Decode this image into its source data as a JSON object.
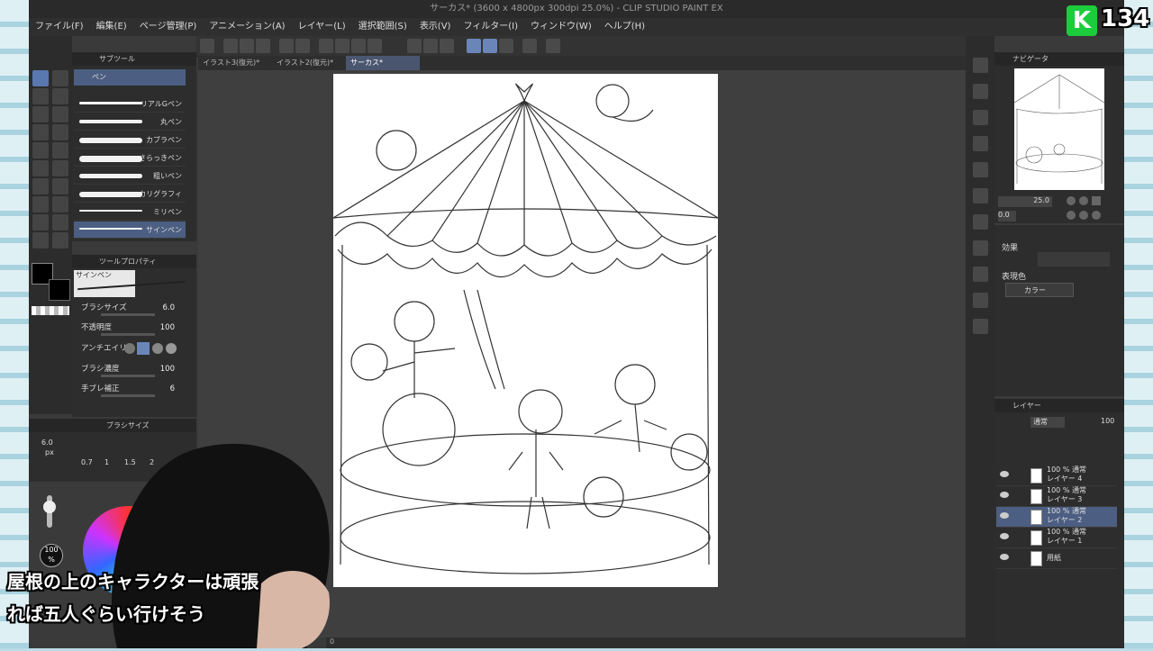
{
  "window": {
    "title": "サーカス* (3600 x 4800px 300dpi 25.0%)  - CLIP STUDIO PAINT EX"
  },
  "menu": [
    "ファイル(F)",
    "編集(E)",
    "ページ管理(P)",
    "アニメーション(A)",
    "レイヤー(L)",
    "選択範囲(S)",
    "表示(V)",
    "フィルター(I)",
    "ウィンドウ(W)",
    "ヘルプ(H)"
  ],
  "tabs": [
    {
      "label": "イラスト3(復元)*"
    },
    {
      "label": "イラスト2(復元)*"
    },
    {
      "label": "サーカス*"
    }
  ],
  "subtool": {
    "header": "サブツール",
    "group": "ペン",
    "brushes": [
      "リアルGペン",
      "丸ペン",
      "カブラペン",
      "さらっきペン",
      "粗いペン",
      "カリグラフィ",
      "ミリペン",
      "サインペン"
    ],
    "selected_index": 7
  },
  "toolprop": {
    "header": "ツールプロパティ",
    "brush_name": "サインペン",
    "brush_size_label": "ブラシサイズ",
    "brush_size": "6.0",
    "opacity_label": "不透明度",
    "opacity": "100",
    "antialias_label": "アンチエイリ",
    "density_label": "ブラシ濃度",
    "density": "100",
    "stabilize_label": "手ブレ補正",
    "stabilize": "6"
  },
  "brushsize_panel": {
    "header": "ブラシサイズ",
    "current": "6.0",
    "unit": "px",
    "presets": [
      "0.7",
      "1",
      "1.5",
      "2"
    ],
    "opacity": "100",
    "opacity_unit": "%"
  },
  "navigator": {
    "header": "ナビゲータ",
    "zoom": "25.0",
    "angle": "0.0"
  },
  "effect": {
    "header": "効果",
    "expr_label": "表現色",
    "expr_value": "カラー"
  },
  "layers": {
    "header": "レイヤー",
    "blend": "通常",
    "opacity": "100",
    "items": [
      {
        "mode": "100 % 通常",
        "name": "レイヤー 4"
      },
      {
        "mode": "100 % 通常",
        "name": "レイヤー 3"
      },
      {
        "mode": "100 % 通常",
        "name": "レイヤー 2"
      },
      {
        "mode": "100 % 通常",
        "name": "レイヤー 1"
      },
      {
        "mode": "",
        "name": "用紙"
      }
    ],
    "selected_index": 2
  },
  "caption": {
    "line1": "屋根の上のキャラクターは頑張",
    "line2": "れば五人ぐらい行けそう"
  },
  "badge": {
    "letter": "K",
    "number": "134"
  },
  "status": {
    "zoom": "0"
  },
  "colors": {
    "accent": "#5a78b0",
    "selection": "#4c5e82",
    "main": "#000000",
    "sub": "#000000"
  }
}
